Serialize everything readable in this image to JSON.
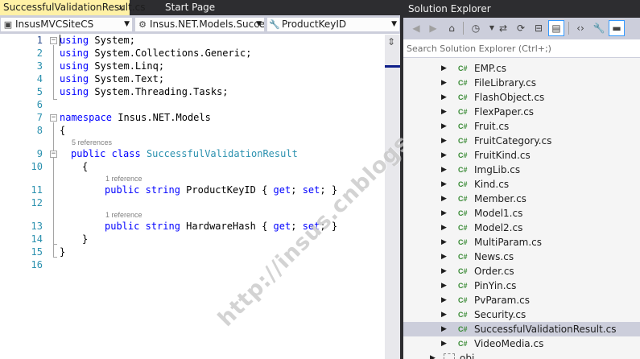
{
  "editor": {
    "tabs": [
      {
        "label": "SuccessfulValidationResult.cs",
        "close": "×"
      },
      {
        "label": "Start Page"
      }
    ],
    "nav": {
      "project": "InsusMVCSiteCS",
      "class": "Insus.NET.Models.Succe",
      "member": "ProductKeyID"
    },
    "code_lines": [
      {
        "n": "1",
        "text": "using System;"
      },
      {
        "n": "2",
        "text": "using System.Collections.Generic;"
      },
      {
        "n": "3",
        "text": "using System.Linq;"
      },
      {
        "n": "4",
        "text": "using System.Text;"
      },
      {
        "n": "5",
        "text": "using System.Threading.Tasks;"
      },
      {
        "n": "6",
        "text": ""
      },
      {
        "n": "7",
        "text": "namespace Insus.NET.Models"
      },
      {
        "n": "8",
        "text": "{"
      },
      {
        "n": "9",
        "text": "public class SuccessfulValidationResult"
      },
      {
        "n": "10",
        "text": "{"
      },
      {
        "n": "11",
        "text": "public string ProductKeyID { get; set; }"
      },
      {
        "n": "12",
        "text": ""
      },
      {
        "n": "13",
        "text": "public string HardwareHash { get; set; }"
      },
      {
        "n": "14",
        "text": "}"
      },
      {
        "n": "15",
        "text": "}"
      },
      {
        "n": "16",
        "text": ""
      }
    ],
    "tokens": {
      "using": "using",
      "System": " System;",
      "SCG": " System.Collections.Generic;",
      "SL": " System.Linq;",
      "ST": " System.Text;",
      "STT": " System.Threading.Tasks;",
      "namespace": "namespace",
      "ns_name": " Insus.NET.Models",
      "public": "public",
      "class": "class",
      "string": "string",
      "get": "get",
      "set": "set",
      "class_name": "SuccessfulValidationResult",
      "prop1": " ProductKeyID { ",
      "prop2": " HardwareHash { ",
      "semi_sp": "; ",
      "semi_close": "; }",
      "open_brace": "{",
      "close_brace": "}",
      "sp": " "
    },
    "codelens": {
      "class_refs": "5 references",
      "prop1_refs": "1 reference",
      "prop2_refs": "1 reference"
    },
    "fold_minus": "−",
    "watermark": "http://insus.cnblogs.com"
  },
  "solution_explorer": {
    "title": "Solution Explorer",
    "search_placeholder": "Search Solution Explorer (Ctrl+;)",
    "cs_badge": "C#",
    "expand_glyph": "▶",
    "toolbar_icons": [
      "back-icon",
      "forward-icon",
      "home-icon",
      "history-icon",
      "sync-icon",
      "refresh-icon",
      "collapse-icon",
      "show-all-files-icon",
      "view-code-icon",
      "properties-icon",
      "preview-icon"
    ],
    "files": [
      "EMP.cs",
      "FileLibrary.cs",
      "FlashObject.cs",
      "FlexPaper.cs",
      "Fruit.cs",
      "FruitCategory.cs",
      "FruitKind.cs",
      "ImgLib.cs",
      "Kind.cs",
      "Member.cs",
      "Model1.cs",
      "Model2.cs",
      "MultiParam.cs",
      "News.cs",
      "Order.cs",
      "PinYin.cs",
      "PvParam.cs",
      "Security.cs",
      "SuccessfulValidationResult.cs",
      "VideoMedia.cs"
    ],
    "selected_file": "SuccessfulValidationResult.cs",
    "folder": "obj"
  },
  "colors": {
    "keyword": "#0000ff",
    "type": "#2b91af",
    "line_number": "#2b91af",
    "csharp_icon": "#388a34",
    "active_tab": "#fff1a6",
    "chrome": "#2d2d30"
  }
}
